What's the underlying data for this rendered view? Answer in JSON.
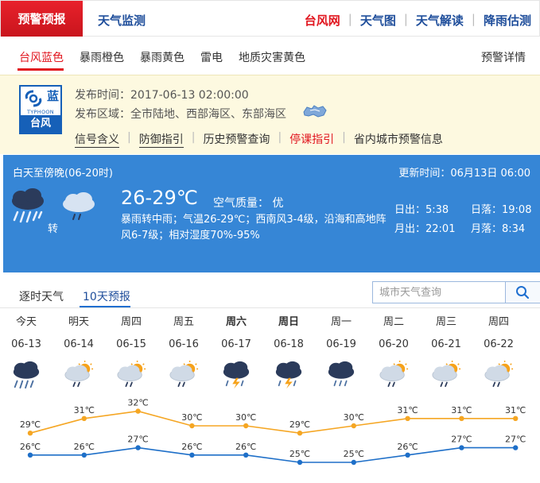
{
  "topbar": {
    "active_tab": "预警预报",
    "tab2": "天气监测",
    "links": [
      {
        "label": "台风网",
        "red": true
      },
      {
        "label": "天气图",
        "red": false
      },
      {
        "label": "天气解读",
        "red": false
      },
      {
        "label": "降雨估测",
        "red": false
      }
    ]
  },
  "alert_tabs": {
    "items": [
      "台风蓝色",
      "暴雨橙色",
      "暴雨黄色",
      "雷电",
      "地质灾害黄色"
    ],
    "active_index": 0,
    "detail": "预警详情"
  },
  "alert": {
    "badge": {
      "level": "蓝",
      "en": "TYPHOON",
      "name": "台风"
    },
    "publish_time": "发布时间：2017-06-13 02:00:00",
    "publish_area": "发布区域：全市陆地、西部海区、东部海区",
    "links": [
      {
        "label": "信号含义",
        "red": false
      },
      {
        "label": "防御指引",
        "red": false
      },
      {
        "label": "历史预警查询",
        "red": false
      },
      {
        "label": "停课指引",
        "red": true
      },
      {
        "label": "省内城市预警信息",
        "red": false
      }
    ]
  },
  "today": {
    "period": "白天至傍晚(06-20时)",
    "update": "更新时间：06月13日 06:00",
    "zhuan": "转",
    "temp": "26-29℃",
    "air_quality": "空气质量： 优",
    "desc": "暴雨转中雨；气温26-29℃；西南风3-4级，沿海和高地阵风6-7级；相对湿度70%-95%",
    "sunrise": "日出：5:38",
    "sunset": "日落：19:08",
    "moonrise": "月出：22:01",
    "moonset": "月落：8:34",
    "icon1": "heavy-rain-icon",
    "icon2": "light-rain-icon"
  },
  "forecast_tabs": {
    "tab1": "逐时天气",
    "tab2": "10天预报",
    "active": 1,
    "search_placeholder": "城市天气查询"
  },
  "days": [
    {
      "week": "今天",
      "date": "06-13",
      "icon": "heavy-rain-icon",
      "bold": false
    },
    {
      "week": "明天",
      "date": "06-14",
      "icon": "sun-rain-icon",
      "bold": false
    },
    {
      "week": "周四",
      "date": "06-15",
      "icon": "sun-rain-icon",
      "bold": false
    },
    {
      "week": "周五",
      "date": "06-16",
      "icon": "sun-rain-icon",
      "bold": false
    },
    {
      "week": "周六",
      "date": "06-17",
      "icon": "thunderstorm-icon",
      "bold": true
    },
    {
      "week": "周日",
      "date": "06-18",
      "icon": "thunderstorm-icon",
      "bold": true
    },
    {
      "week": "周一",
      "date": "06-19",
      "icon": "moderate-rain-icon",
      "bold": false
    },
    {
      "week": "周二",
      "date": "06-20",
      "icon": "sun-rain-icon",
      "bold": false
    },
    {
      "week": "周三",
      "date": "06-21",
      "icon": "sun-rain-icon",
      "bold": false
    },
    {
      "week": "周四",
      "date": "06-22",
      "icon": "sun-rain-icon",
      "bold": false
    }
  ],
  "chart_data": {
    "type": "line",
    "categories": [
      "06-13",
      "06-14",
      "06-15",
      "06-16",
      "06-17",
      "06-18",
      "06-19",
      "06-20",
      "06-21",
      "06-22"
    ],
    "series": [
      {
        "values": [
          29,
          31,
          32,
          30,
          30,
          29,
          30,
          31,
          31,
          31
        ],
        "color": "#f5a623"
      },
      {
        "values": [
          26,
          26,
          27,
          26,
          26,
          25,
          25,
          26,
          27,
          27
        ],
        "color": "#1e6fc8"
      }
    ],
    "unit": "℃"
  },
  "colors": {
    "red": "#e1161f",
    "blue_panel": "#3686d6",
    "nav_blue": "#1f4e9b",
    "alert_bg": "#fdf9e0"
  }
}
